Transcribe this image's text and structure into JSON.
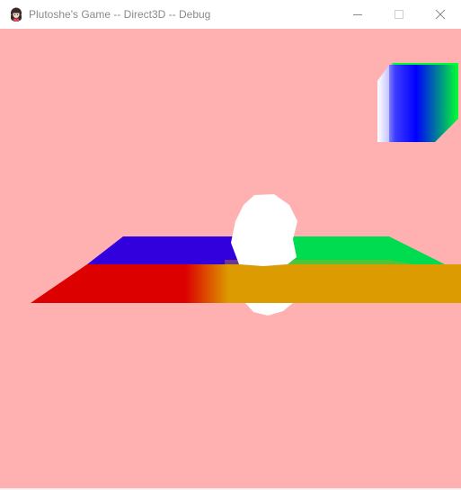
{
  "window": {
    "title": "Plutoshe's Game -- Direct3D -- Debug",
    "caption_buttons": {
      "minimize": "minimize-icon",
      "maximize": "maximize-icon",
      "close": "close-icon"
    }
  },
  "scene": {
    "clear_color": "#ffb1b1",
    "floor_colors": {
      "red": "#dc0000",
      "blue": "#3200dc",
      "green": "#00dc50",
      "orange": "#dc9b00"
    },
    "cube_colors": {
      "white": "#ffffff",
      "blue": "#0000ff",
      "green": "#00ff32"
    },
    "sphere_color": "#ffffff"
  }
}
